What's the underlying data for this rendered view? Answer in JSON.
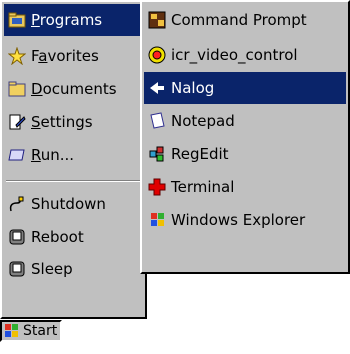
{
  "start_menu": {
    "items": [
      {
        "label_before": "",
        "mnemonic": "P",
        "label_after": "rograms",
        "icon": "programs-folder-icon"
      },
      {
        "label_before": "F",
        "mnemonic": "a",
        "label_after": "vorites",
        "icon": "favorites-star-icon"
      },
      {
        "label_before": "",
        "mnemonic": "D",
        "label_after": "ocuments",
        "icon": "documents-folder-icon"
      },
      {
        "label_before": "",
        "mnemonic": "S",
        "label_after": "ettings",
        "icon": "settings-icon"
      },
      {
        "label_before": "",
        "mnemonic": "R",
        "label_after": "un...",
        "icon": "run-icon"
      },
      {
        "label": "Shutdown",
        "icon": "shutdown-icon"
      },
      {
        "label": "Reboot",
        "icon": "reboot-icon"
      },
      {
        "label": "Sleep",
        "icon": "sleep-icon"
      }
    ]
  },
  "programs_menu": {
    "items": [
      {
        "label": "Command Prompt",
        "icon": "command-prompt-icon"
      },
      {
        "label": "icr_video_control",
        "icon": "video-control-icon"
      },
      {
        "label": "Nalog",
        "icon": "nalog-icon"
      },
      {
        "label": "Notepad",
        "icon": "notepad-icon"
      },
      {
        "label": "RegEdit",
        "icon": "regedit-icon"
      },
      {
        "label": "Terminal",
        "icon": "terminal-icon"
      },
      {
        "label": "Windows Explorer",
        "icon": "windows-explorer-icon"
      }
    ]
  },
  "taskbar": {
    "start_label": "Start"
  },
  "colors": {
    "menu_bg": "#c0c0c0",
    "highlight": "#0a246a",
    "highlight_text": "#ffffff"
  }
}
